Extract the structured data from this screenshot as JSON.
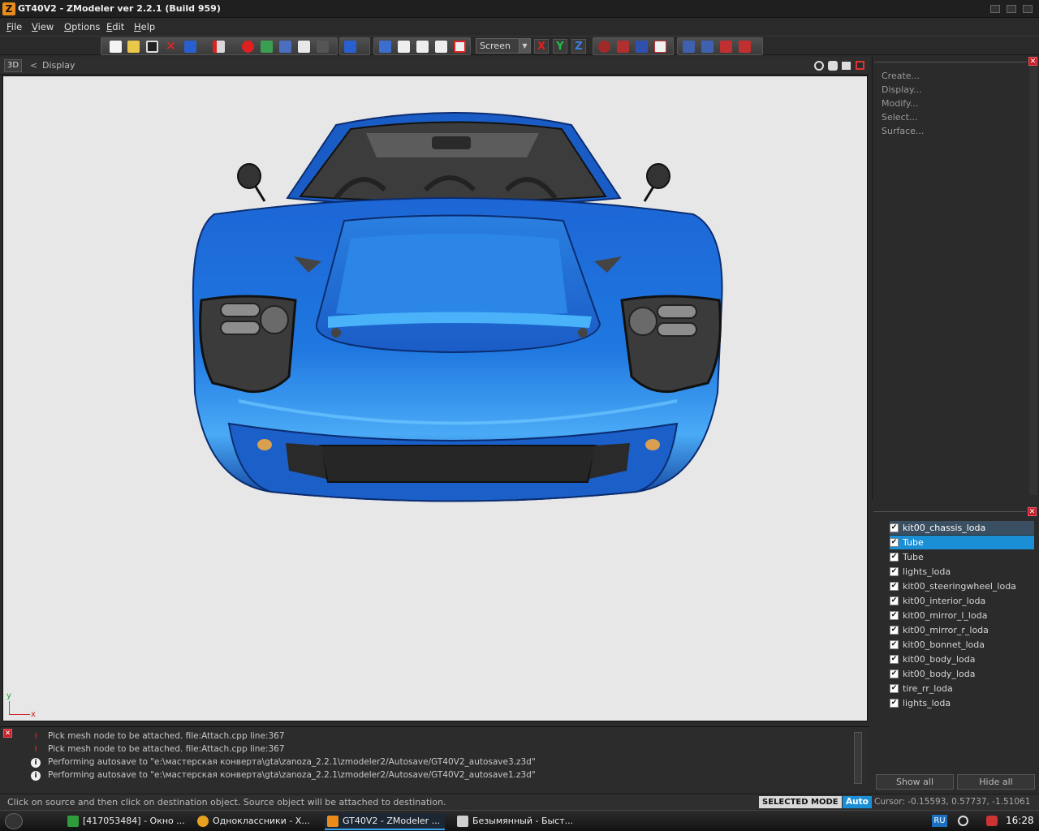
{
  "window": {
    "title": "GT40V2 - ZModeler ver 2.2.1 (Build 959)",
    "logo": "Z"
  },
  "menu": [
    {
      "label": "File"
    },
    {
      "label": "View"
    },
    {
      "label": "Options"
    },
    {
      "label": "Edit"
    },
    {
      "label": "Help"
    }
  ],
  "toolbar": {
    "coord_system": "Screen",
    "axes": [
      "X",
      "Y",
      "Z"
    ]
  },
  "viewport": {
    "mode": "3D",
    "nav_arrow": "<",
    "title": "Display",
    "axis_y": "y",
    "axis_x": "x"
  },
  "command_panel": {
    "commands": [
      "Create...",
      "Display...",
      "Modify...",
      "Select...",
      "Surface..."
    ]
  },
  "objects_panel": {
    "items": [
      {
        "name": "kit00_chassis_loda",
        "checked": true
      },
      {
        "name": "Tube",
        "checked": true
      },
      {
        "name": "Tube",
        "checked": true
      },
      {
        "name": "lights_loda",
        "checked": true
      },
      {
        "name": "kit00_steeringwheel_loda",
        "checked": true
      },
      {
        "name": "kit00_interior_loda",
        "checked": true
      },
      {
        "name": "kit00_mirror_l_loda",
        "checked": true
      },
      {
        "name": "kit00_mirror_r_loda",
        "checked": true
      },
      {
        "name": "kit00_bonnet_loda",
        "checked": true
      },
      {
        "name": "kit00_body_loda",
        "checked": true
      },
      {
        "name": "kit00_body_loda",
        "checked": true
      },
      {
        "name": "tire_rr_loda",
        "checked": true
      },
      {
        "name": "lights_loda",
        "checked": true
      }
    ],
    "check_glyph": "✔",
    "show_all": "Show all",
    "hide_all": "Hide all"
  },
  "log": [
    {
      "type": "error",
      "glyph": "!",
      "text": "Pick mesh node to be attached. file:Attach.cpp line:367"
    },
    {
      "type": "error",
      "glyph": "!",
      "text": "Pick mesh node to be attached. file:Attach.cpp line:367"
    },
    {
      "type": "info",
      "glyph": "i",
      "text": "Performing autosave to \"e:\\мастерская конверта\\gta\\zanoza_2.2.1\\zmodeler2/Autosave/GT40V2_autosave3.z3d\""
    },
    {
      "type": "info",
      "glyph": "i",
      "text": "Performing autosave to \"e:\\мастерская конверта\\gta\\zanoza_2.2.1\\zmodeler2/Autosave/GT40V2_autosave1.z3d\""
    }
  ],
  "status": {
    "message": "Click on source and then click on destination object. Source object will be attached to destination.",
    "mode": "SELECTED MODE",
    "auto": "Auto",
    "cursor": "Cursor: -0.15593, 0.57737, -1.51061"
  },
  "taskbar": {
    "tasks": [
      {
        "label": "[417053484] - Окно ..."
      },
      {
        "label": "Одноклассники - Х..."
      },
      {
        "label": "GT40V2 - ZModeler ..."
      },
      {
        "label": "Безымянный - Быст..."
      }
    ],
    "lang": "RU",
    "clock": "16:28"
  },
  "colors": {
    "accent": "#1b8fd6",
    "car_body": "#1e6fd8",
    "viewport_bg": "#e7e7e7",
    "error": "#d0202a"
  }
}
